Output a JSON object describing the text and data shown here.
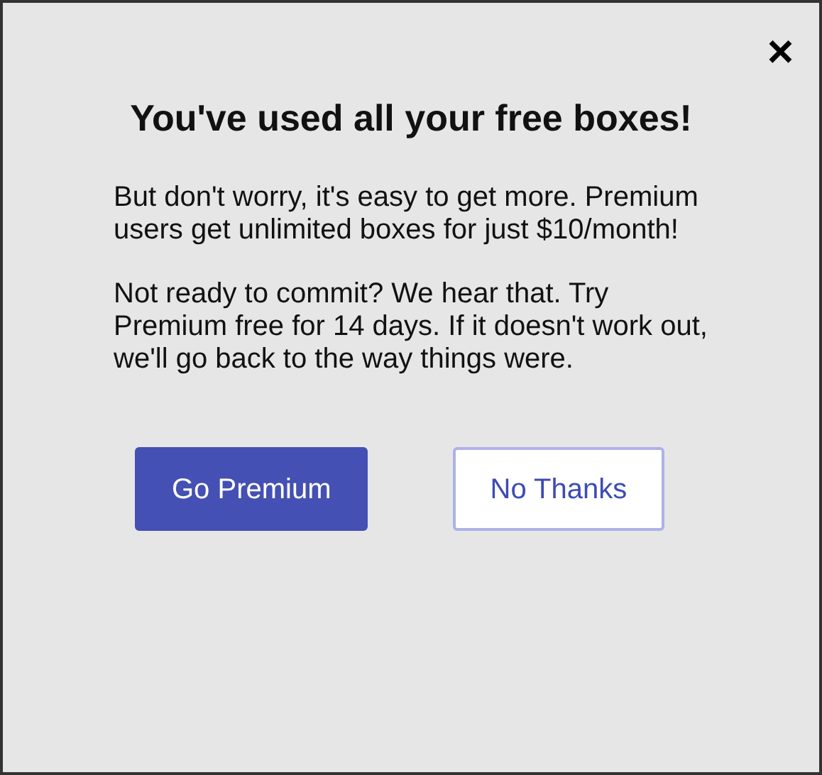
{
  "dialog": {
    "close": "×",
    "title": "You've used all your free boxes!",
    "paragraphs": [
      "But don't worry, it's easy to get more. Premium users get unlimited boxes for just $10/month!",
      "Not ready to commit? We hear that. Try Premium free for 14 days. If it doesn't work out, we'll go back to the way things were."
    ],
    "buttons": [
      {
        "label": "Go Premium",
        "kind": "primary"
      },
      {
        "label": "No Thanks",
        "kind": "secondary"
      }
    ]
  }
}
